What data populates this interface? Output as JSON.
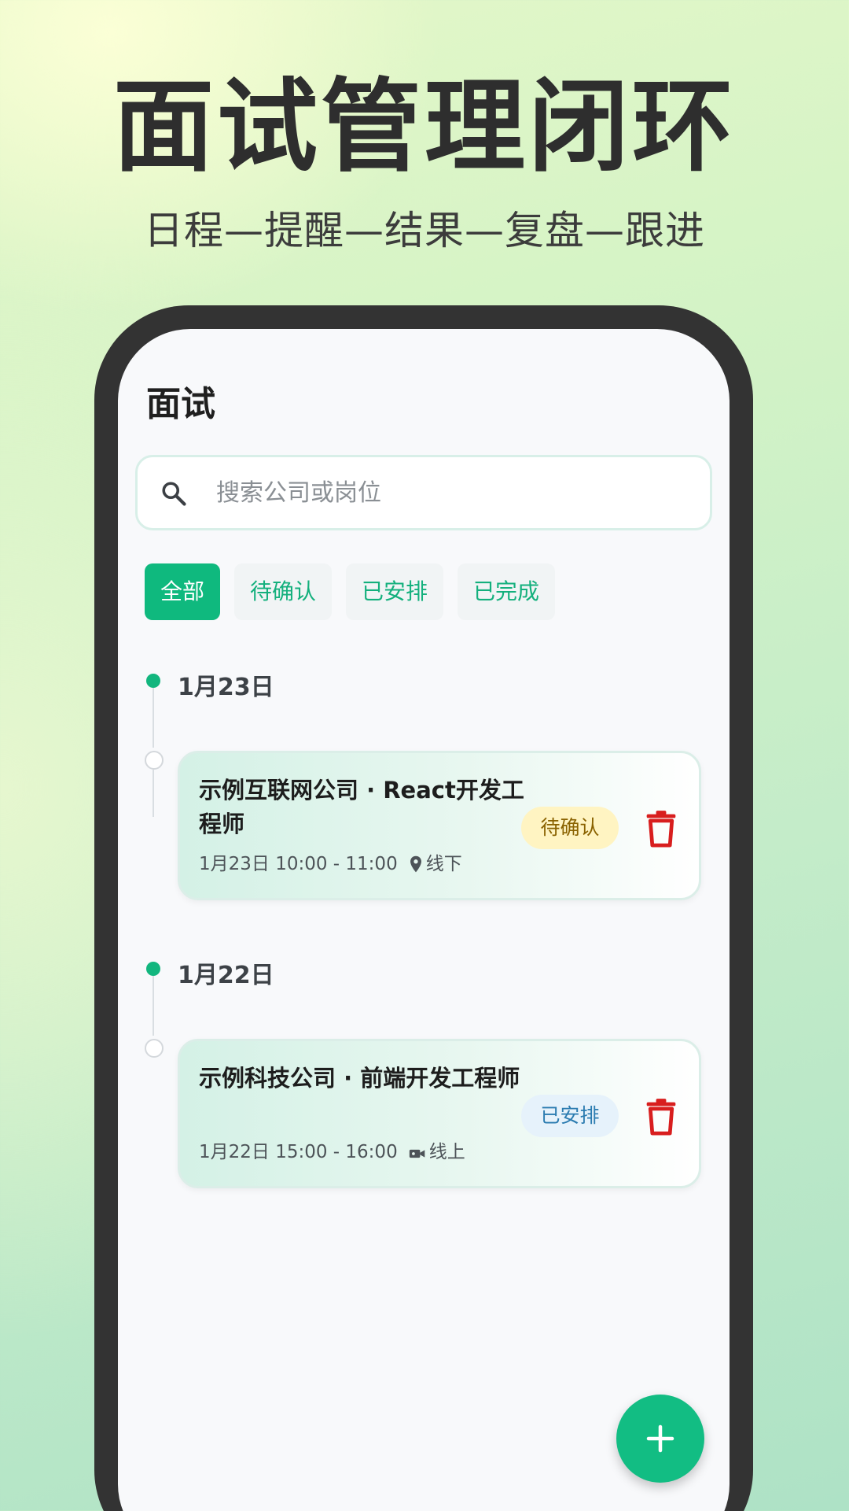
{
  "hero": {
    "title": "面试管理闭环",
    "subtitle": "日程—提醒—结果—复盘—跟进"
  },
  "app": {
    "page_title": "面试",
    "search": {
      "placeholder": "搜索公司或岗位",
      "value": "",
      "icon": "search-icon"
    },
    "filters": [
      {
        "label": "全部",
        "active": true
      },
      {
        "label": "待确认",
        "active": false
      },
      {
        "label": "已安排",
        "active": false
      },
      {
        "label": "已完成",
        "active": false
      }
    ],
    "groups": [
      {
        "date": "1月23日",
        "items": [
          {
            "title": "示例互联网公司 · React开发工程师",
            "time": "1月23日 10:00 - 11:00",
            "mode_icon": "location-pin-icon",
            "mode": "线下",
            "status": "待确认",
            "status_color": "#fff4c2",
            "delete_icon": "trash-icon"
          }
        ]
      },
      {
        "date": "1月22日",
        "items": [
          {
            "title": "示例科技公司 · 前端开发工程师",
            "time": "1月22日 15:00 - 16:00",
            "mode_icon": "video-camera-icon",
            "mode": "线上",
            "status": "已安排",
            "status_color": "#e6f2fb",
            "delete_icon": "trash-icon"
          }
        ]
      }
    ],
    "fab_icon": "plus-icon",
    "colors": {
      "accent": "#0fb97e",
      "danger": "#d81e1e",
      "frame": "#333333"
    }
  }
}
